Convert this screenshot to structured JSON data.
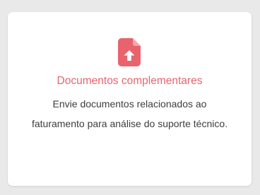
{
  "card": {
    "icon": "file-upload-icon",
    "icon_color": "#e8636e",
    "title": "Documentos complementares",
    "description": "Envie documentos relacionados ao faturamento para análise do suporte técnico."
  }
}
